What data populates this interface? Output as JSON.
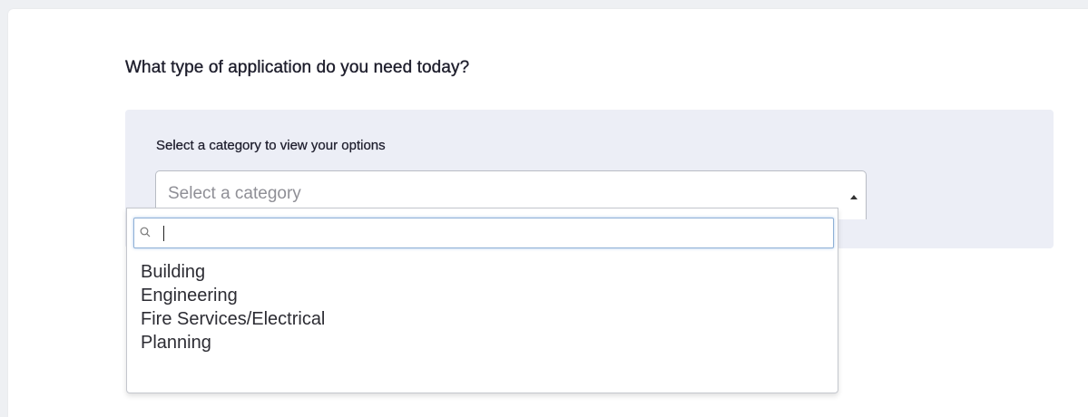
{
  "question": {
    "title": "What type of application do you need today?"
  },
  "category": {
    "label": "Select a category to view your options",
    "placeholder": "Select a category",
    "search": {
      "value": "",
      "icon": "search-icon"
    },
    "options": [
      "Building",
      "Engineering",
      "Fire Services/Electrical",
      "Planning"
    ]
  },
  "colors": {
    "panel_bg": "#eceef6",
    "search_focus_border": "#8fb0d6"
  }
}
